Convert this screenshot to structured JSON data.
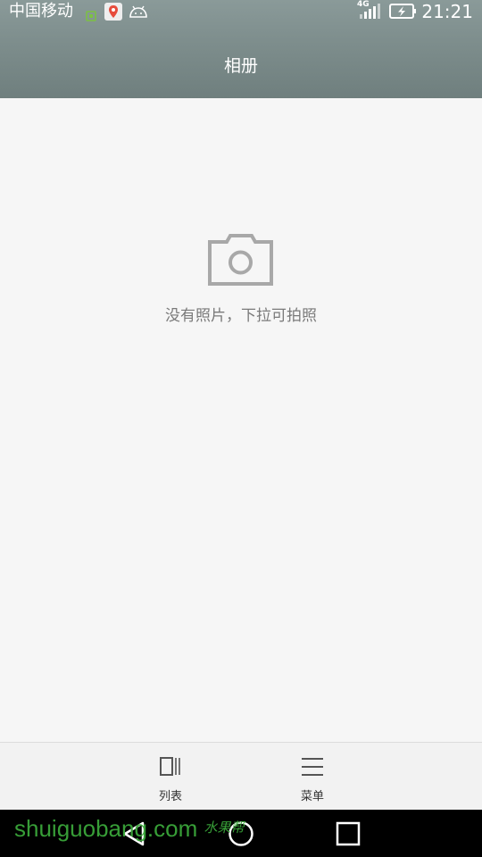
{
  "status_bar": {
    "carrier": "中国移动",
    "network": "4G",
    "time": "21:21",
    "icons": [
      "sim-icon",
      "map-pin-icon",
      "android-icon",
      "signal-icon",
      "battery-charging-icon"
    ]
  },
  "app_bar": {
    "title": "相册"
  },
  "empty_state": {
    "icon": "camera-icon",
    "message": "没有照片，下拉可拍照"
  },
  "toolbar": {
    "items": [
      {
        "label": "列表",
        "icon": "list-view-icon"
      },
      {
        "label": "菜单",
        "icon": "menu-icon"
      }
    ]
  },
  "nav_bar": {
    "buttons": [
      "back-icon",
      "home-icon",
      "recents-icon"
    ]
  },
  "watermark": {
    "text": "shuiguobang.com",
    "chinese": "水果帮"
  },
  "colors": {
    "header": "#7d8d8c",
    "background": "#f6f6f6",
    "empty_icon": "#a8a8a8",
    "empty_text": "#7a7a7a",
    "watermark": "#3aa63a"
  }
}
